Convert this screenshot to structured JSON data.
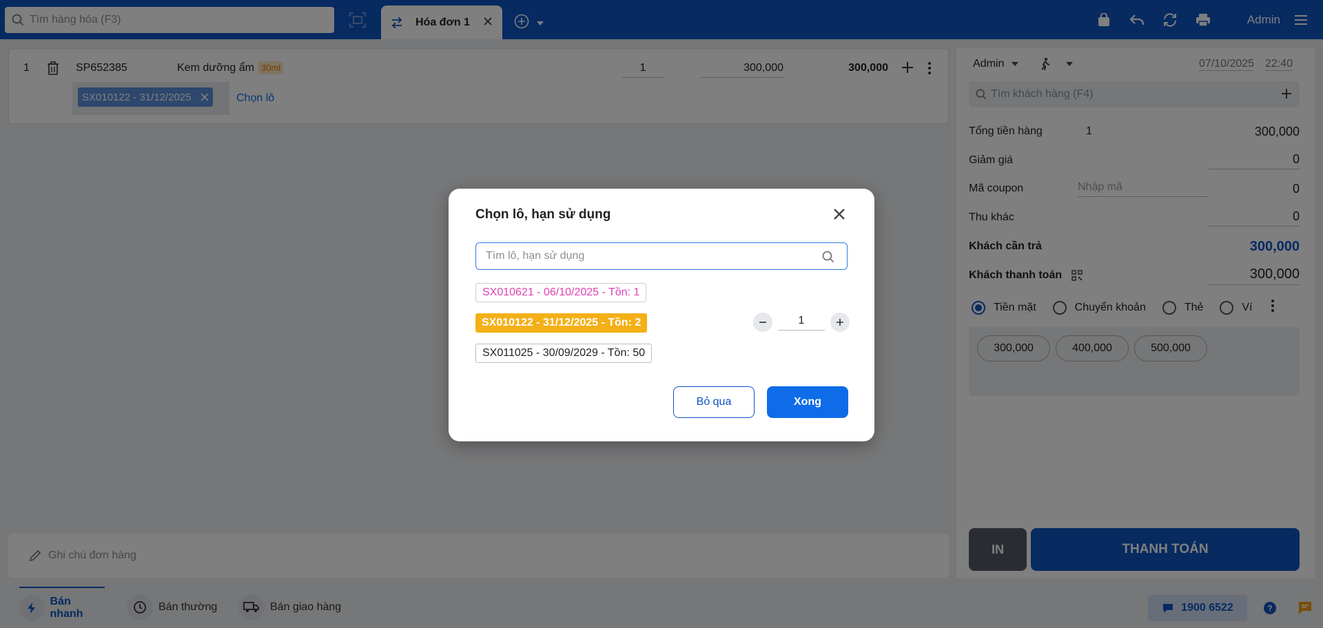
{
  "topbar": {
    "search_placeholder": "Tìm hàng hóa (F3)",
    "active_tab": "Hóa đơn 1",
    "user": "Admin"
  },
  "cart": {
    "row": {
      "index": "1",
      "sku": "SP652385",
      "name": "Kem dưỡng ẩm",
      "unit_tag": "30ml",
      "qty": "1",
      "price": "300,000",
      "total": "300,000"
    },
    "lot_chip": "SX010122 - 31/12/2025",
    "choose_lot": "Chọn lô"
  },
  "note_placeholder": "Ghi chú đơn hàng",
  "right": {
    "seller": "Admin",
    "date": "07/10/2025",
    "time": "22:40",
    "customer_search": "Tìm khách hàng (F4)",
    "total_label": "Tổng tiền hàng",
    "total_qty": "1",
    "total_value": "300,000",
    "discount_label": "Giảm giá",
    "discount_value": "0",
    "coupon_label": "Mã coupon",
    "coupon_placeholder": "Nhập mã",
    "coupon_value": "0",
    "other_label": "Thu khác",
    "other_value": "0",
    "due_label": "Khách cần trả",
    "due_value": "300,000",
    "paid_label": "Khách thanh toán",
    "paid_value": "300,000",
    "methods": [
      "Tiền mặt",
      "Chuyển khoản",
      "Thẻ",
      "Ví"
    ],
    "quick_amounts": [
      "300,000",
      "400,000",
      "500,000"
    ],
    "print_label": "IN",
    "pay_label": "THANH TOÁN"
  },
  "bottombar": {
    "modes": [
      "Bán nhanh",
      "Bán thường",
      "Bán giao hàng"
    ],
    "hotline": "1900 6522"
  },
  "modal": {
    "title": "Chọn lô, hạn sử dụng",
    "search_placeholder": "Tìm lô, hạn sử dụng",
    "lots": [
      "SX010621 - 06/10/2025 - Tồn: 1",
      "SX010122 - 31/12/2025 - Tồn: 2",
      "SX011025 - 30/09/2029 - Tồn: 50"
    ],
    "selected_qty": "1",
    "cancel_label": "Bỏ qua",
    "done_label": "Xong"
  },
  "colors": {
    "brand": "#0e54c3",
    "expired_lot": "#e041b5",
    "selected_lot": "#f4b017"
  }
}
